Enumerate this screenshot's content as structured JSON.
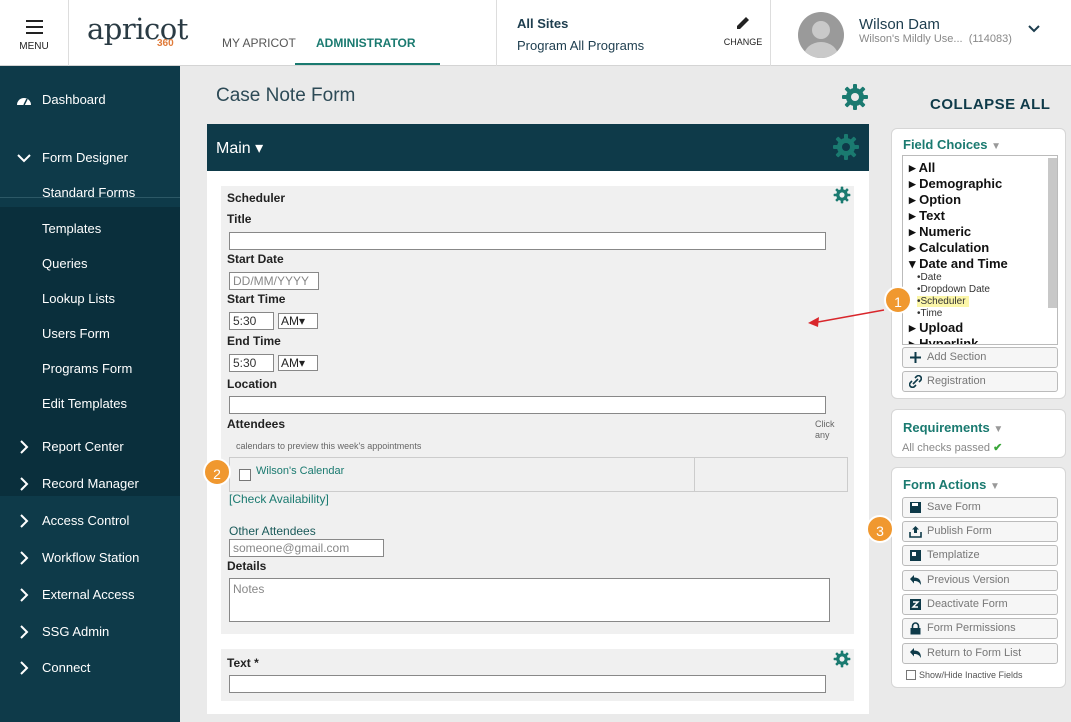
{
  "topbar": {
    "menu_label": "MENU",
    "logo_text": "apricot",
    "logo_sub": "360",
    "tab_my": "MY APRICOT",
    "tab_admin": "ADMINISTRATOR",
    "site": "All Sites",
    "program": "Program All Programs",
    "change_label": "CHANGE",
    "user_name": "Wilson Dam",
    "user_sub": "Wilson's Mildly Use...",
    "user_id": "(114083)"
  },
  "sidebar": {
    "dashboard": "Dashboard",
    "form_designer": "Form Designer",
    "sub_items": [
      "Standard Forms",
      "Templates",
      "Queries",
      "Lookup Lists",
      "Users Form",
      "Programs Form",
      "Edit Templates"
    ],
    "items": [
      "Report Center",
      "Record Manager",
      "Access Control",
      "Workflow Station",
      "External Access",
      "SSG Admin",
      "Connect"
    ]
  },
  "form": {
    "page_title": "Case Note Form",
    "section_title": "Main",
    "scheduler": {
      "heading": "Scheduler",
      "title_label": "Title",
      "start_date_label": "Start Date",
      "start_date_placeholder": "DD/MM/YYYY",
      "start_time_label": "Start Time",
      "start_time_value": "5:30",
      "start_ampm": "AM",
      "end_time_label": "End Time",
      "end_time_value": "5:30",
      "end_ampm": "AM",
      "location_label": "Location",
      "attendees_label": "Attendees",
      "click_any": "Click any",
      "calendar_hint": "calendars to preview this week's appointments",
      "calendar_name": "Wilson's Calendar",
      "check_availability": "[Check Availability]",
      "other_attendees_label": "Other Attendees",
      "other_attendees_placeholder": "someone@gmail.com",
      "details_label": "Details",
      "details_placeholder": "Notes"
    },
    "text_field_label": "Text *"
  },
  "right_panel": {
    "collapse_all": "COLLAPSE ALL",
    "field_choices": {
      "title": "Field Choices",
      "tree": [
        "All",
        "Demographic",
        "Option",
        "Text",
        "Numeric",
        "Calculation",
        "Date and Time"
      ],
      "date_children": [
        "Date",
        "Dropdown Date",
        "Scheduler",
        "Time"
      ],
      "tree_after": [
        "Upload",
        "Hyperlink"
      ],
      "add_section": "Add Section",
      "registration": "Registration"
    },
    "requirements": {
      "title": "Requirements",
      "status": "All checks passed"
    },
    "form_actions": {
      "title": "Form Actions",
      "buttons": [
        "Save Form",
        "Publish Form",
        "Templatize",
        "Previous Version",
        "Deactivate Form",
        "Form Permissions",
        "Return to Form List"
      ],
      "show_hide": "Show/Hide Inactive Fields"
    }
  },
  "annotations": {
    "badges": [
      "1",
      "2",
      "3"
    ],
    "badge_color": "#f0982f",
    "arrow_color": "#d9262b"
  },
  "colors": {
    "sidebar_bg": "#0e3a49",
    "accent": "#1a7a70"
  }
}
